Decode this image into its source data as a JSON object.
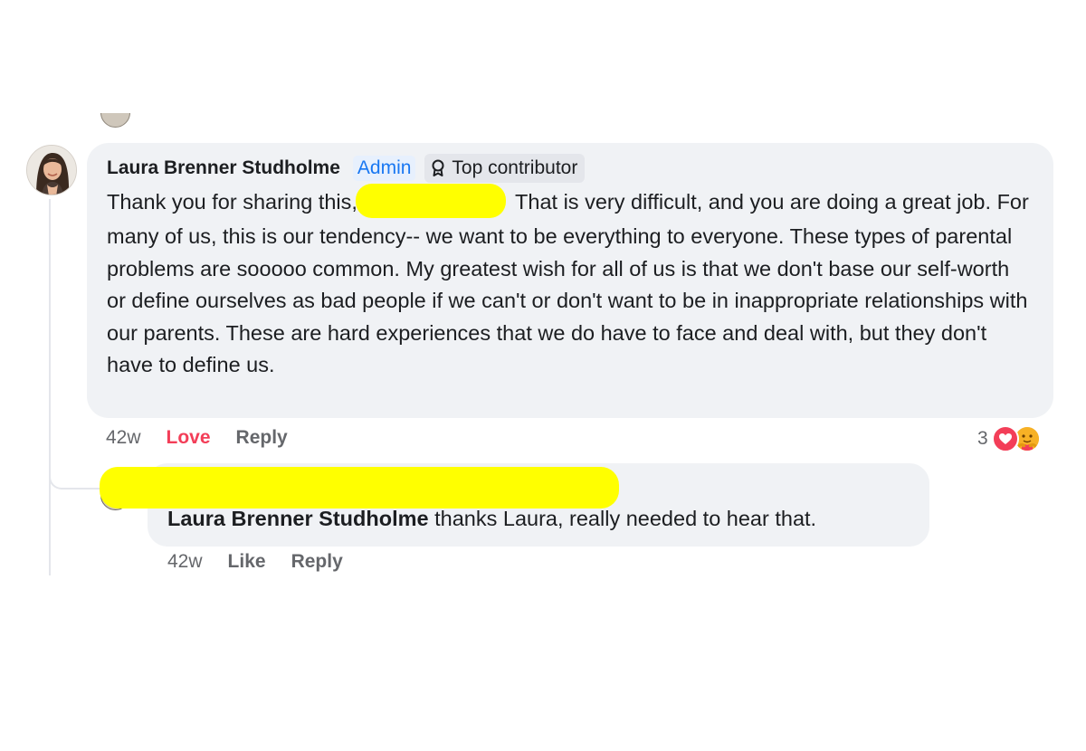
{
  "comment": {
    "author": "Laura Brenner Studholme",
    "badges": {
      "admin": "Admin",
      "top_contributor": "Top contributor"
    },
    "text_before_redaction": "Thank you for sharing this,",
    "text_after_redaction": " That is very difficult, and you are doing a great job. For many of us, this is our tendency-- we want to be everything to everyone. These types of parental problems are sooooo common. My greatest wish for all of us is that we don't base our self-worth or define ourselves as bad people if we can't or don't want to be in inappropriate relationships with our parents. These are hard experiences that we do have to face and deal with, but they don't have to define us.",
    "time": "42w",
    "reaction_label": "Love",
    "reply_label": "Reply",
    "reaction_count": "3",
    "reaction_icons": [
      "heart-icon",
      "care-icon"
    ]
  },
  "reply": {
    "mention": "Laura Brenner Studholme",
    "text": " thanks Laura, really needed to hear that.",
    "time": "42w",
    "like_label": "Like",
    "reply_label": "Reply"
  },
  "colors": {
    "bubble": "#f0f2f5",
    "admin_blue": "#1877f2",
    "love_red": "#f33e58",
    "meta_gray": "#65676b",
    "redaction_yellow": "#ffff00"
  }
}
